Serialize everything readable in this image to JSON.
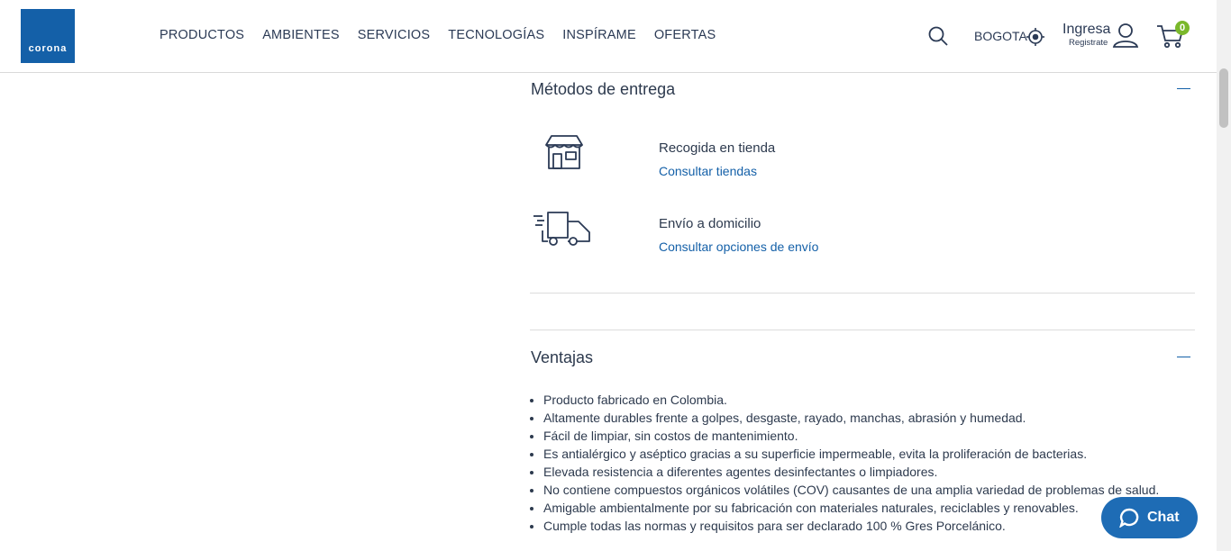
{
  "header": {
    "logo_text": "corona",
    "nav": [
      "PRODUCTOS",
      "AMBIENTES",
      "SERVICIOS",
      "TECNOLOGÍAS",
      "INSPÍRAME",
      "OFERTAS"
    ],
    "city": "BOGOTA",
    "login_label": "Ingresa",
    "register_label": "Registrate",
    "cart_count": "0",
    "icons": [
      "search-icon",
      "location-icon",
      "user-icon",
      "cart-icon"
    ]
  },
  "delivery": {
    "title": "Métodos de entrega",
    "options": [
      {
        "icon": "store-icon",
        "title": "Recogida en tienda",
        "link": "Consultar tiendas"
      },
      {
        "icon": "truck-icon",
        "title": "Envío a domicilio",
        "link": "Consultar opciones de envío"
      }
    ]
  },
  "advantages": {
    "title": "Ventajas",
    "items": [
      "Producto fabricado en Colombia.",
      "Altamente durables frente a golpes, desgaste, rayado, manchas, abrasión y humedad.",
      "Fácil de limpiar, sin costos de mantenimiento.",
      "Es antialérgico y aséptico gracias a su superficie impermeable, evita la proliferación de bacterias.",
      "Elevada resistencia a diferentes agentes desinfectantes o limpiadores.",
      "No contiene compuestos orgánicos volátiles (COV)  causantes de una amplia variedad de problemas de salud.",
      "Amigable ambientalmente por su fabricación con materiales naturales, reciclables y renovables.",
      "Cumple todas las normas y requisitos para ser declarado 100 % Gres Porcelánico."
    ]
  },
  "chat": {
    "label": "Chat"
  },
  "colors": {
    "brand": "#1460a8",
    "badge": "#7ab82b",
    "chat": "#1e6cb5"
  }
}
